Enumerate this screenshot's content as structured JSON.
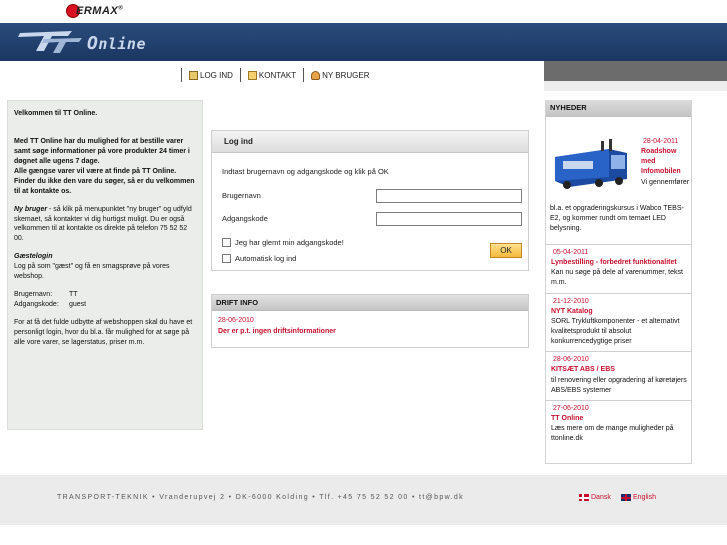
{
  "brand": {
    "name": "ERMAX",
    "mark": "®",
    "logo_suffix": "Online"
  },
  "nav": {
    "items": [
      {
        "label": "LOG IND",
        "icon": "login-icon"
      },
      {
        "label": "KONTAKT",
        "icon": "mail-icon"
      },
      {
        "label": "NY BRUGER",
        "icon": "user-icon"
      }
    ]
  },
  "left_panel": {
    "welcome": "Velkommen til TT Online.",
    "intro": "Med TT Online har du mulighed for at bestille varer samt søge informationer på vore produkter 24 timer i døgnet alle ugens 7 dage.",
    "intro2": "Alle gængse varer vil være at finde på TT Online. Finder du ikke den vare du søger, så er du velkommen til at kontakte os.",
    "new_user_title": "Ny bruger",
    "new_user_text": " - så klik på menupunktet \"ny bruger\" og udfyld skemaet, så kontakter vi dig hurtigst muligt. Du er også velkommen til at kontakte os direkte på telefon 75 52 52 00.",
    "guest_title": "Gæstelogin",
    "guest_text": "Log på som \"gæst\" og få en smagsprøve på vores webshop.",
    "username_label": "Brugernavn:",
    "username_value": "TT",
    "password_label": "Adgangskode:",
    "password_value": "guest",
    "outro": "For at få det fulde udbytte af webshoppen skal du have et personligt login, hvor du bl.a. får mulighed for at søge på alle vore varer, se lagerstatus, priser m.m."
  },
  "login": {
    "title": "Log ind",
    "intro": "Indtast brugernavn og adgangskode og klik på OK",
    "username_label": "Brugernavn",
    "username_value": "",
    "password_label": "Adgangskode",
    "password_value": "",
    "forgot_label": "Jeg har glemt min adgangskode!",
    "auto_label": "Automatisk log ind",
    "ok_label": "OK"
  },
  "drift": {
    "title": "DRIFT INFO",
    "date": "28-06-2010",
    "text": "Der er p.t. ingen driftsinformationer"
  },
  "news": {
    "title": "NYHEDER",
    "featured": {
      "date": "28-04-2011",
      "title": "Roadshow med Infomobilen",
      "text_right": "Vi gennemfører",
      "text_bottom": "bl.a. et opgraderingskursus i Wabco TEBS-E2, og kommer rundt om temaet LED belysning."
    },
    "items": [
      {
        "date": "05-04-2011",
        "title": "Lynbestilling - forbedret funktionalitet",
        "text": "Kan nu søge på dele af varenummer, tekst m.m."
      },
      {
        "date": "21-12-2010",
        "title": "NYT Katalog",
        "text": "SORL Trykluftkomponenter - et alternativt kvalitetsprodukt til absolut konkurrencedygtige priser"
      },
      {
        "date": "28-06-2010",
        "title": "KITSÆT ABS / EBS",
        "text": "til renovering eller opgradering af køretøjers ABS/EBS systemer"
      },
      {
        "date": "27-06-2010",
        "title": "TT Online",
        "text": "Læs mere om de mange muligheder på ttonline.dk"
      }
    ]
  },
  "footer": {
    "text": "TRANSPORT-TEKNIK • Vranderupvej 2 • DK-6000 Kolding • Tlf. +45 75 52 52 00 • tt@bpw.dk",
    "lang_da": "Dansk",
    "lang_en": "English"
  },
  "colors": {
    "header": "#1b3761",
    "accent_red": "#c8102e",
    "ok_button": "#f5b93a"
  }
}
